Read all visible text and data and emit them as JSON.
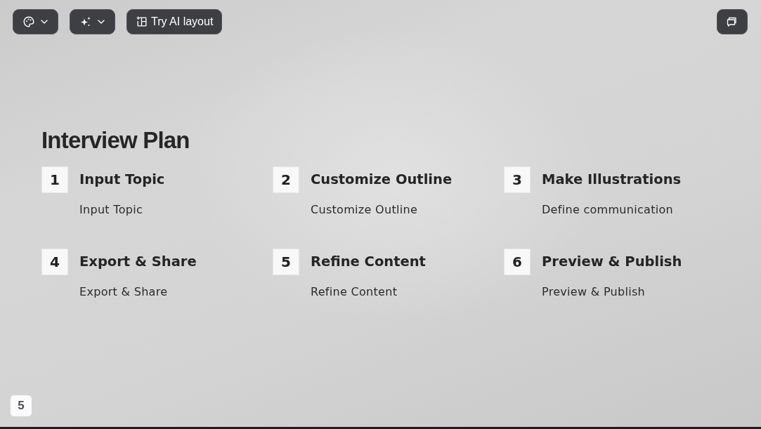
{
  "toolbar": {
    "layout_button": {
      "label": "Try AI layout"
    }
  },
  "slide": {
    "title": "Interview Plan",
    "steps": [
      {
        "number": "1",
        "title": "Input Topic",
        "description": "Input Topic"
      },
      {
        "number": "2",
        "title": "Customize Outline",
        "description": "Customize Outline"
      },
      {
        "number": "3",
        "title": "Make Illustrations",
        "description": "Define communication"
      },
      {
        "number": "4",
        "title": "Export & Share",
        "description": "Export & Share"
      },
      {
        "number": "5",
        "title": "Refine Content",
        "description": "Refine Content"
      },
      {
        "number": "6",
        "title": "Preview & Publish",
        "description": "Preview & Publish"
      }
    ],
    "page_number": "5"
  }
}
